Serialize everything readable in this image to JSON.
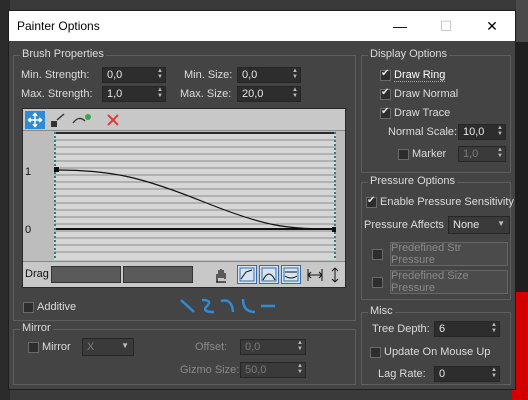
{
  "window": {
    "title": "Painter Options",
    "controls": {
      "minimize": "—",
      "maximize": "☐",
      "close": "✕"
    }
  },
  "brush_properties": {
    "title": "Brush Properties",
    "min_strength_label": "Min. Strength:",
    "min_strength_value": "0,0",
    "max_strength_label": "Max. Strength:",
    "max_strength_value": "1,0",
    "min_size_label": "Min. Size:",
    "min_size_value": "0,0",
    "max_size_label": "Max. Size:",
    "max_size_value": "20,0",
    "curve": {
      "y_top_label": "1",
      "y_bottom_label": "0",
      "drag_label": "Drag"
    },
    "additive_label": "Additive",
    "additive_checked": false
  },
  "mirror": {
    "title": "Mirror",
    "mirror_label": "Mirror",
    "mirror_checked": false,
    "axis_value": "X",
    "offset_label": "Offset:",
    "offset_value": "0,0",
    "gizmo_label": "Gizmo Size:",
    "gizmo_value": "50,0"
  },
  "display_options": {
    "title": "Display Options",
    "draw_ring": "Draw Ring",
    "draw_normal": "Draw Normal",
    "draw_trace": "Draw Trace",
    "normal_scale_label": "Normal Scale:",
    "normal_scale_value": "10,0",
    "marker_label": "Marker",
    "marker_value": "1,0"
  },
  "pressure_options": {
    "title": "Pressure Options",
    "enable_label": "Enable Pressure Sensitivity",
    "affects_label": "Pressure Affects",
    "affects_value": "None",
    "predef_str_label": "Predefined Str Pressure",
    "predef_size_label": "Predefined Size Pressure"
  },
  "misc": {
    "title": "Misc",
    "tree_depth_label": "Tree Depth:",
    "tree_depth_value": "6",
    "update_label": "Update On Mouse Up",
    "lag_label": "Lag Rate:",
    "lag_value": "0"
  },
  "colors": {
    "panel": "#444444",
    "field": "#2d2d2d",
    "accent_blue": "#2f8bd8",
    "delete_red": "#e23a3a"
  }
}
